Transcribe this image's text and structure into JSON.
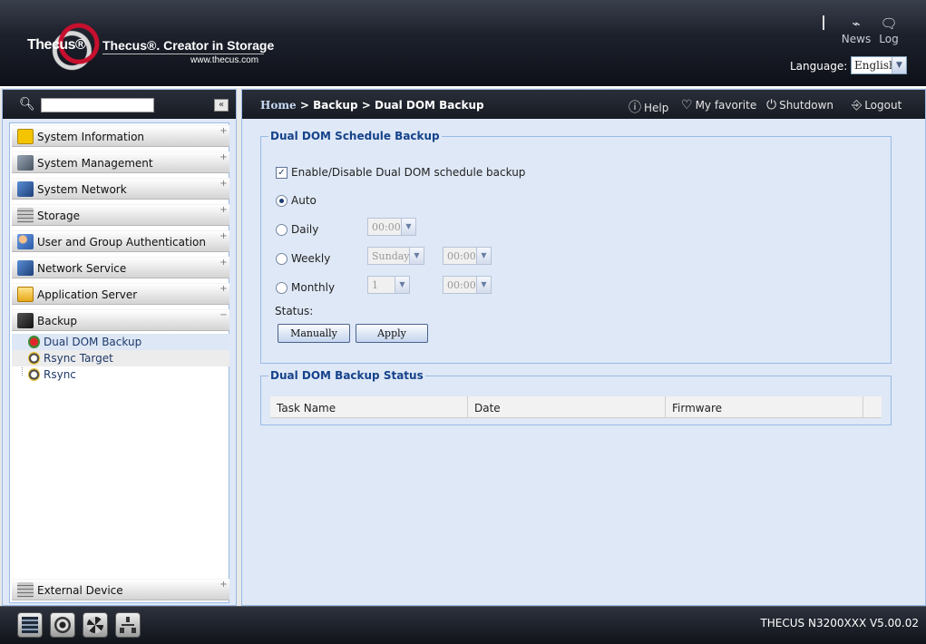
{
  "header": {
    "logo_text": "Thecus®",
    "tagline": "Thecus®. Creator in Storage",
    "url": "www.thecus.com",
    "news_label": "News",
    "log_label": "Log",
    "language_label": "Language:",
    "language_value": "English"
  },
  "sidebar": {
    "search_placeholder": "",
    "collapse_glyph": "«",
    "menu": [
      {
        "label": "System Information",
        "icon": "info-icon",
        "toggle": "+"
      },
      {
        "label": "System Management",
        "icon": "tools-icon",
        "toggle": "+"
      },
      {
        "label": "System Network",
        "icon": "network-icon",
        "toggle": "+"
      },
      {
        "label": "Storage",
        "icon": "storage-icon",
        "toggle": "+"
      },
      {
        "label": "User and Group Authentication",
        "icon": "users-icon",
        "toggle": "+"
      },
      {
        "label": "Network Service",
        "icon": "network-service-icon",
        "toggle": "+"
      },
      {
        "label": "Application Server",
        "icon": "folder-icon",
        "toggle": "+"
      },
      {
        "label": "Backup",
        "icon": "backup-icon",
        "toggle": "−"
      }
    ],
    "backup_items": [
      {
        "label": "Dual DOM Backup",
        "icon": "dom-backup-icon"
      },
      {
        "label": "Rsync Target",
        "icon": "rsync-target-icon"
      },
      {
        "label": "Rsync",
        "icon": "rsync-icon"
      }
    ],
    "external_device": {
      "label": "External Device",
      "icon": "external-device-icon",
      "toggle": "+"
    }
  },
  "content": {
    "breadcrumb": {
      "home": "Home",
      "path": " > Backup > Dual DOM Backup"
    },
    "nav": {
      "help": "Help",
      "favorite": "My favorite",
      "shutdown": "Shutdown",
      "logout": "Logout"
    },
    "schedule": {
      "title": "Dual DOM Schedule Backup",
      "enable_label": "Enable/Disable Dual DOM schedule backup",
      "enable_checked": true,
      "selected_mode": "Auto",
      "auto_label": "Auto",
      "daily_label": "Daily",
      "daily_time": "00:00",
      "weekly_label": "Weekly",
      "weekly_day": "Sunday",
      "weekly_time": "00:00",
      "monthly_label": "Monthly",
      "monthly_day": "1",
      "monthly_time": "00:00",
      "status_label": "Status:",
      "manually_button": "Manually",
      "apply_button": "Apply"
    },
    "status": {
      "title": "Dual DOM Backup Status",
      "columns": [
        "Task Name",
        "Date",
        "Firmware"
      ]
    }
  },
  "footer": {
    "version": "THECUS N3200XXX V5.00.02",
    "icons": [
      "server-status-icon",
      "disk-icon",
      "fan-icon",
      "network-topology-icon"
    ]
  },
  "colors": {
    "panel_bg": "#dfe8f6",
    "panel_border": "#99bbe8",
    "legend_text": "#15428b",
    "header_dark": "#161a22",
    "brand_red": "#c8102e"
  }
}
